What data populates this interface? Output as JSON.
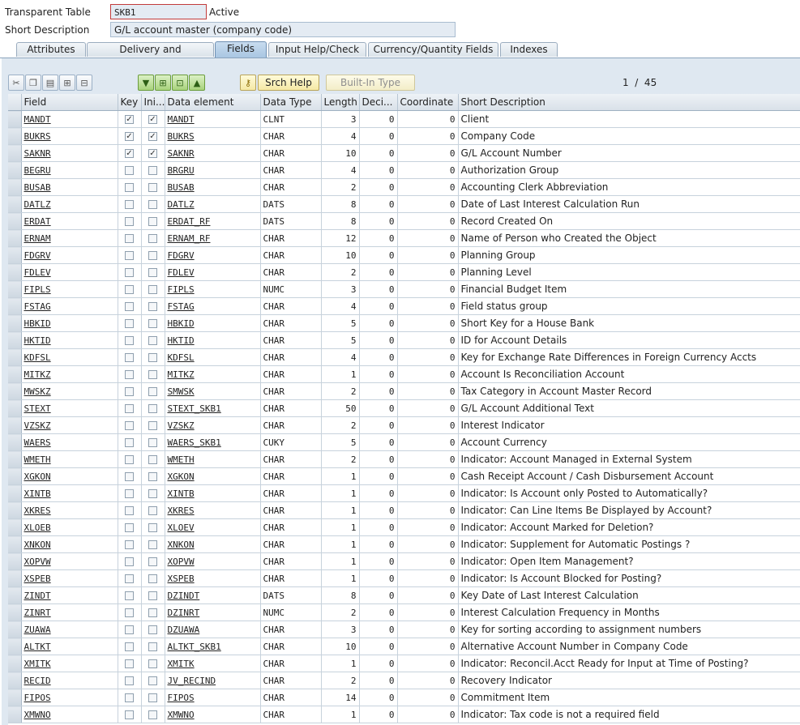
{
  "header": {
    "table_label": "Transparent Table",
    "table_name": "SKB1",
    "status": "Active",
    "desc_label": "Short Description",
    "desc_value": "G/L account master (company code)"
  },
  "tabs": [
    {
      "label": "Attributes",
      "active": false
    },
    {
      "label": "Delivery and Maintenance",
      "active": false
    },
    {
      "label": "Fields",
      "active": true
    },
    {
      "label": "Input Help/Check",
      "active": false
    },
    {
      "label": "Currency/Quantity Fields",
      "active": false
    },
    {
      "label": "Indexes",
      "active": false
    }
  ],
  "toolbar": {
    "srch_help": "Srch Help",
    "built_in_type": "Built-In Type",
    "pager": "1  /  45"
  },
  "columns": [
    "Field",
    "Key",
    "Ini...",
    "Data element",
    "Data Type",
    "Length",
    "Deci...",
    "Coordinate",
    "Short Description"
  ],
  "rows": [
    {
      "field": "MANDT",
      "key": true,
      "ini": true,
      "elem": "MANDT",
      "type": "CLNT",
      "len": "3",
      "dec": "0",
      "coord": "0",
      "desc": "Client"
    },
    {
      "field": "BUKRS",
      "key": true,
      "ini": true,
      "elem": "BUKRS",
      "type": "CHAR",
      "len": "4",
      "dec": "0",
      "coord": "0",
      "desc": "Company Code"
    },
    {
      "field": "SAKNR",
      "key": true,
      "ini": true,
      "elem": "SAKNR",
      "type": "CHAR",
      "len": "10",
      "dec": "0",
      "coord": "0",
      "desc": "G/L Account Number"
    },
    {
      "field": "BEGRU",
      "key": false,
      "ini": false,
      "elem": "BRGRU",
      "type": "CHAR",
      "len": "4",
      "dec": "0",
      "coord": "0",
      "desc": "Authorization Group"
    },
    {
      "field": "BUSAB",
      "key": false,
      "ini": false,
      "elem": "BUSAB",
      "type": "CHAR",
      "len": "2",
      "dec": "0",
      "coord": "0",
      "desc": "Accounting Clerk Abbreviation"
    },
    {
      "field": "DATLZ",
      "key": false,
      "ini": false,
      "elem": "DATLZ",
      "type": "DATS",
      "len": "8",
      "dec": "0",
      "coord": "0",
      "desc": "Date of Last Interest Calculation Run"
    },
    {
      "field": "ERDAT",
      "key": false,
      "ini": false,
      "elem": "ERDAT_RF",
      "type": "DATS",
      "len": "8",
      "dec": "0",
      "coord": "0",
      "desc": "Record Created On"
    },
    {
      "field": "ERNAM",
      "key": false,
      "ini": false,
      "elem": "ERNAM_RF",
      "type": "CHAR",
      "len": "12",
      "dec": "0",
      "coord": "0",
      "desc": "Name of Person who Created the Object"
    },
    {
      "field": "FDGRV",
      "key": false,
      "ini": false,
      "elem": "FDGRV",
      "type": "CHAR",
      "len": "10",
      "dec": "0",
      "coord": "0",
      "desc": "Planning Group"
    },
    {
      "field": "FDLEV",
      "key": false,
      "ini": false,
      "elem": "FDLEV",
      "type": "CHAR",
      "len": "2",
      "dec": "0",
      "coord": "0",
      "desc": "Planning Level"
    },
    {
      "field": "FIPLS",
      "key": false,
      "ini": false,
      "elem": "FIPLS",
      "type": "NUMC",
      "len": "3",
      "dec": "0",
      "coord": "0",
      "desc": "Financial Budget Item"
    },
    {
      "field": "FSTAG",
      "key": false,
      "ini": false,
      "elem": "FSTAG",
      "type": "CHAR",
      "len": "4",
      "dec": "0",
      "coord": "0",
      "desc": "Field status group"
    },
    {
      "field": "HBKID",
      "key": false,
      "ini": false,
      "elem": "HBKID",
      "type": "CHAR",
      "len": "5",
      "dec": "0",
      "coord": "0",
      "desc": "Short Key for a House Bank"
    },
    {
      "field": "HKTID",
      "key": false,
      "ini": false,
      "elem": "HKTID",
      "type": "CHAR",
      "len": "5",
      "dec": "0",
      "coord": "0",
      "desc": "ID for Account Details"
    },
    {
      "field": "KDFSL",
      "key": false,
      "ini": false,
      "elem": "KDFSL",
      "type": "CHAR",
      "len": "4",
      "dec": "0",
      "coord": "0",
      "desc": "Key for Exchange Rate Differences in Foreign Currency Accts"
    },
    {
      "field": "MITKZ",
      "key": false,
      "ini": false,
      "elem": "MITKZ",
      "type": "CHAR",
      "len": "1",
      "dec": "0",
      "coord": "0",
      "desc": "Account Is Reconciliation Account"
    },
    {
      "field": "MWSKZ",
      "key": false,
      "ini": false,
      "elem": "SMWSK",
      "type": "CHAR",
      "len": "2",
      "dec": "0",
      "coord": "0",
      "desc": "Tax Category in Account Master Record"
    },
    {
      "field": "STEXT",
      "key": false,
      "ini": false,
      "elem": "STEXT_SKB1",
      "type": "CHAR",
      "len": "50",
      "dec": "0",
      "coord": "0",
      "desc": "G/L Account Additional Text"
    },
    {
      "field": "VZSKZ",
      "key": false,
      "ini": false,
      "elem": "VZSKZ",
      "type": "CHAR",
      "len": "2",
      "dec": "0",
      "coord": "0",
      "desc": "Interest Indicator"
    },
    {
      "field": "WAERS",
      "key": false,
      "ini": false,
      "elem": "WAERS_SKB1",
      "type": "CUKY",
      "len": "5",
      "dec": "0",
      "coord": "0",
      "desc": "Account Currency"
    },
    {
      "field": "WMETH",
      "key": false,
      "ini": false,
      "elem": "WMETH",
      "type": "CHAR",
      "len": "2",
      "dec": "0",
      "coord": "0",
      "desc": "Indicator: Account Managed in External System"
    },
    {
      "field": "XGKON",
      "key": false,
      "ini": false,
      "elem": "XGKON",
      "type": "CHAR",
      "len": "1",
      "dec": "0",
      "coord": "0",
      "desc": "Cash Receipt Account / Cash Disbursement Account"
    },
    {
      "field": "XINTB",
      "key": false,
      "ini": false,
      "elem": "XINTB",
      "type": "CHAR",
      "len": "1",
      "dec": "0",
      "coord": "0",
      "desc": "Indicator: Is Account only Posted to Automatically?"
    },
    {
      "field": "XKRES",
      "key": false,
      "ini": false,
      "elem": "XKRES",
      "type": "CHAR",
      "len": "1",
      "dec": "0",
      "coord": "0",
      "desc": "Indicator: Can Line Items Be Displayed by Account?"
    },
    {
      "field": "XLOEB",
      "key": false,
      "ini": false,
      "elem": "XLOEV",
      "type": "CHAR",
      "len": "1",
      "dec": "0",
      "coord": "0",
      "desc": "Indicator: Account Marked for Deletion?"
    },
    {
      "field": "XNKON",
      "key": false,
      "ini": false,
      "elem": "XNKON",
      "type": "CHAR",
      "len": "1",
      "dec": "0",
      "coord": "0",
      "desc": "Indicator: Supplement for Automatic Postings ?"
    },
    {
      "field": "XOPVW",
      "key": false,
      "ini": false,
      "elem": "XOPVW",
      "type": "CHAR",
      "len": "1",
      "dec": "0",
      "coord": "0",
      "desc": "Indicator: Open Item Management?"
    },
    {
      "field": "XSPEB",
      "key": false,
      "ini": false,
      "elem": "XSPEB",
      "type": "CHAR",
      "len": "1",
      "dec": "0",
      "coord": "0",
      "desc": "Indicator: Is Account Blocked for Posting?"
    },
    {
      "field": "ZINDT",
      "key": false,
      "ini": false,
      "elem": "DZINDT",
      "type": "DATS",
      "len": "8",
      "dec": "0",
      "coord": "0",
      "desc": "Key Date of Last Interest Calculation"
    },
    {
      "field": "ZINRT",
      "key": false,
      "ini": false,
      "elem": "DZINRT",
      "type": "NUMC",
      "len": "2",
      "dec": "0",
      "coord": "0",
      "desc": "Interest Calculation Frequency in Months"
    },
    {
      "field": "ZUAWA",
      "key": false,
      "ini": false,
      "elem": "DZUAWA",
      "type": "CHAR",
      "len": "3",
      "dec": "0",
      "coord": "0",
      "desc": "Key for sorting according to assignment numbers"
    },
    {
      "field": "ALTKT",
      "key": false,
      "ini": false,
      "elem": "ALTKT_SKB1",
      "type": "CHAR",
      "len": "10",
      "dec": "0",
      "coord": "0",
      "desc": "Alternative Account Number in Company Code"
    },
    {
      "field": "XMITK",
      "key": false,
      "ini": false,
      "elem": "XMITK",
      "type": "CHAR",
      "len": "1",
      "dec": "0",
      "coord": "0",
      "desc": "Indicator: Reconcil.Acct Ready for Input at Time of Posting?"
    },
    {
      "field": "RECID",
      "key": false,
      "ini": false,
      "elem": "JV_RECIND",
      "type": "CHAR",
      "len": "2",
      "dec": "0",
      "coord": "0",
      "desc": "Recovery Indicator"
    },
    {
      "field": "FIPOS",
      "key": false,
      "ini": false,
      "elem": "FIPOS",
      "type": "CHAR",
      "len": "14",
      "dec": "0",
      "coord": "0",
      "desc": "Commitment Item"
    },
    {
      "field": "XMWNO",
      "key": false,
      "ini": false,
      "elem": "XMWNO",
      "type": "CHAR",
      "len": "1",
      "dec": "0",
      "coord": "0",
      "desc": "Indicator: Tax code is not a required field"
    }
  ]
}
